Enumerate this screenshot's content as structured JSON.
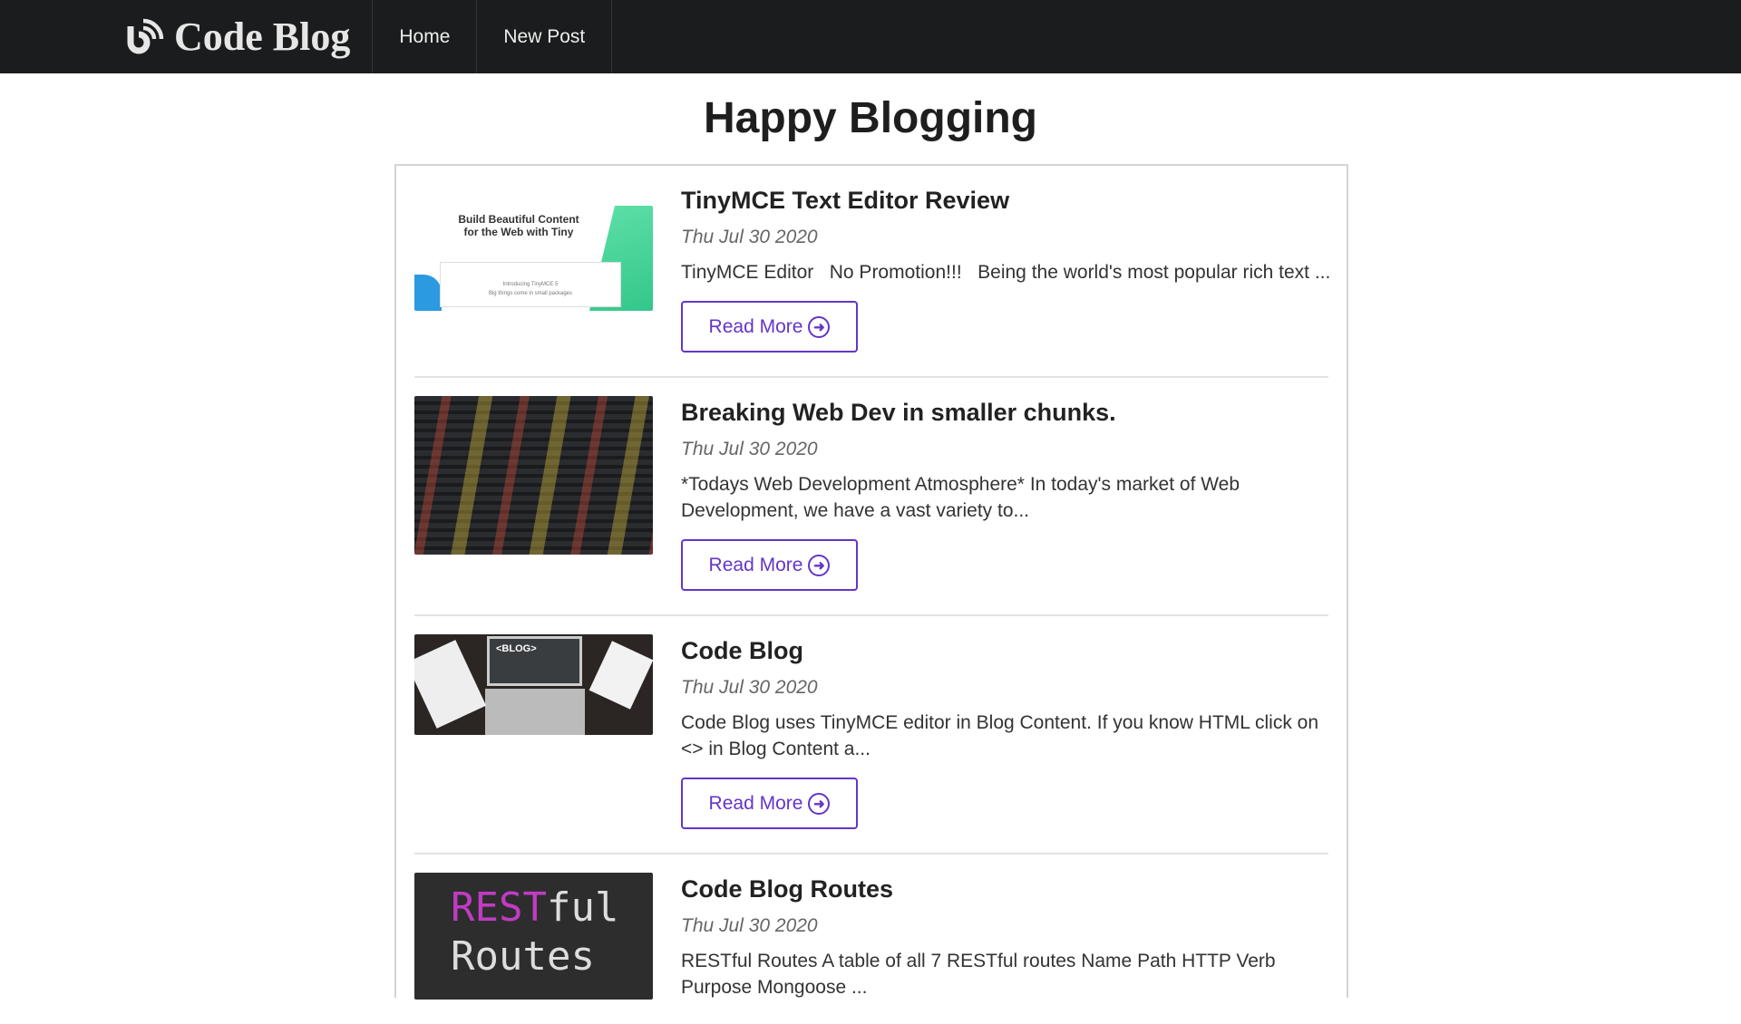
{
  "nav": {
    "brand": "Code Blog",
    "items": [
      "Home",
      "New Post"
    ]
  },
  "page_title": "Happy Blogging",
  "read_more": "Read More",
  "posts": [
    {
      "title": "TinyMCE Text Editor Review",
      "date": "Thu Jul 30 2020",
      "excerpt": "TinyMCE Editor   No Promotion!!!   Being the world's most popular rich text ...",
      "thumb_text": [
        "Build Beautiful Content for the Web with Tiny",
        "Introducing TinyMCE 5",
        "Big things come in small packages"
      ]
    },
    {
      "title": "Breaking Web Dev in smaller chunks.",
      "date": "Thu Jul 30 2020",
      "excerpt": "*Todays Web Development Atmosphere* In today's market of Web Development, we have a vast variety to..."
    },
    {
      "title": "Code Blog",
      "date": "Thu Jul 30 2020",
      "excerpt": "Code Blog uses TinyMCE editor in Blog Content. If you know HTML click on <> in Blog Content a...",
      "thumb_text": [
        "<BLOG>"
      ]
    },
    {
      "title": "Code Blog Routes",
      "date": "Thu Jul 30 2020",
      "excerpt": "RESTful Routes A table of all 7 RESTful routes Name Path HTTP Verb Purpose Mongoose ...",
      "thumb_text": [
        "REST",
        "ful",
        "Routes"
      ]
    }
  ]
}
